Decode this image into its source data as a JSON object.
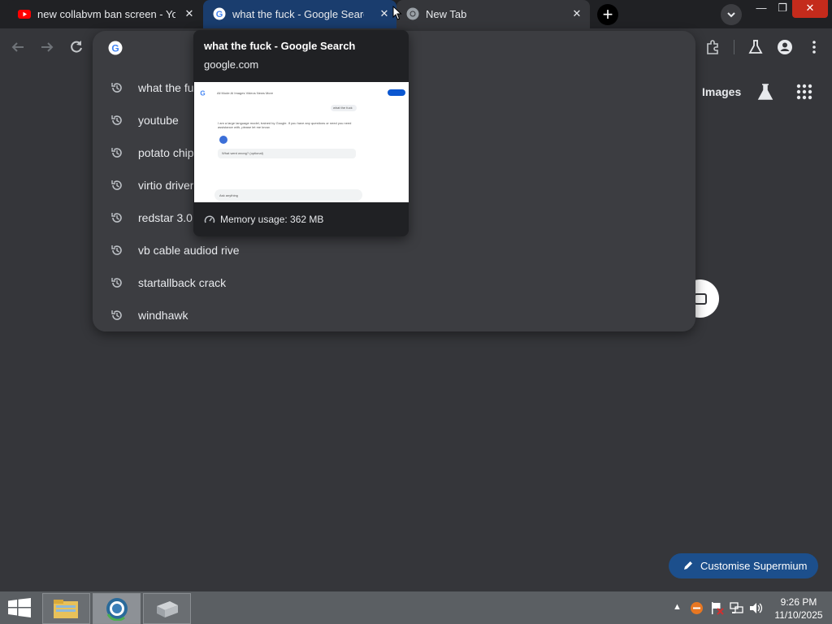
{
  "tabs": [
    {
      "title": "new collabvm ban screen - YouT",
      "icon": "youtube-icon"
    },
    {
      "title": "what the fuck - Google Search",
      "icon": "google-icon"
    },
    {
      "title": "New Tab",
      "icon": "chrome-icon"
    }
  ],
  "window": {
    "close_symbol": "✕",
    "min_symbol": "—",
    "max_symbol": "❐"
  },
  "new_tab_symbol": "+",
  "suggestions": [
    "what the fu",
    "youtube",
    "potato chip",
    "virtio driver",
    "redstar 3.0",
    "vb cable audiod rive",
    "startallback crack",
    "windhawk"
  ],
  "header": {
    "images_label": "Images"
  },
  "hovercard": {
    "title": "what the fuck - Google Search",
    "domain": "google.com",
    "memory": "Memory usage: 362 MB",
    "preview": {
      "query": "what the fuck",
      "answer": "I am a large language model, trained by Google. If you have any questions or need you need assistance with, please let me know.",
      "followup": "What went wrong? (optional)",
      "ask": "Ask anything",
      "tabs": "All  Mode  AI  Images  Videos  News  More"
    }
  },
  "customise": {
    "label": "Customise Supermium"
  },
  "clock": {
    "time": "9:26 PM",
    "date": "11/10/2025"
  },
  "colors": {
    "accent": "#1c4f8c",
    "close_red": "#c42b1c",
    "bg": "#35363a"
  }
}
